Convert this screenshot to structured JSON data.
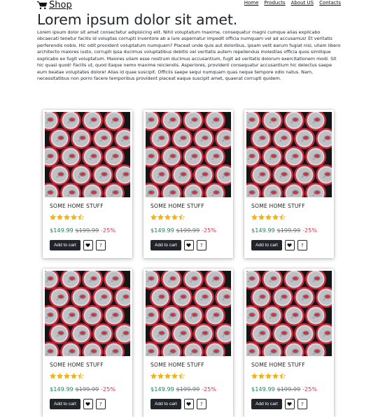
{
  "header": {
    "brand": "Shop",
    "nav": [
      "Home",
      "Products",
      "About US",
      "Contacts"
    ]
  },
  "hero": {
    "title": "Lorem ipsum dolor sit amet.",
    "text": "Lorem ipsum dolor sit amet consectetur adipisicing elit. Nihil voluptatum maxime, consequatur magni cumque alias explicabo obcaecati tenetur facilis id voluptas corrupti inventore ab a iure aspernatur impedit officia numquam vel ad accusamus! Et veritatis perferendis nobis. Hic odit provident voluptatum numquam? Placeat unde quis aut doloribus, ipsam velit earum fugiat nisi, ullam libero architecto maiores iusto, corrupti ipsa ducimus voluptatibus debitis vel veritatis autem repellendus molestias officia quos similique explicabo ex fugit voluptatum. Maiores ullam esse nostrum ducimus accusantium, fugit ad veritatis dolorum exercitationem modi. Sit hic quasi quod! Facilis ut, quod itaque nemo maxime reiciendis. Asperiores, provident consequatur accusantium hic delectus saepe eum beatae voluptates dolore! Alias id quae suscipit. Officiis saepe sequi numquam quas neque tempore odio natus. Nam, necessitatibus non porro facere temporibus provident placeat eaque suscipit amet, quaerat corrupti quidem."
  },
  "products": [
    {
      "name": "SOME HOME STUFF",
      "rating": 4.5,
      "price": "$149.99",
      "old_price": "$199.99",
      "discount": "-25%",
      "add_to_cart": "Add to cart",
      "help": "?"
    },
    {
      "name": "SOME HOME STUFF",
      "rating": 4.5,
      "price": "$149.99",
      "old_price": "$199.99",
      "discount": "-25%",
      "add_to_cart": "Add to cart",
      "help": "?"
    },
    {
      "name": "SOME HOME STUFF",
      "rating": 4.5,
      "price": "$149.99",
      "old_price": "$199.99",
      "discount": "-25%",
      "add_to_cart": "Add to cart",
      "help": "?"
    }
  ],
  "colors": {
    "price": "#198754",
    "discount": "#dc3545",
    "star": "#f5b50a",
    "button": "#212529"
  }
}
